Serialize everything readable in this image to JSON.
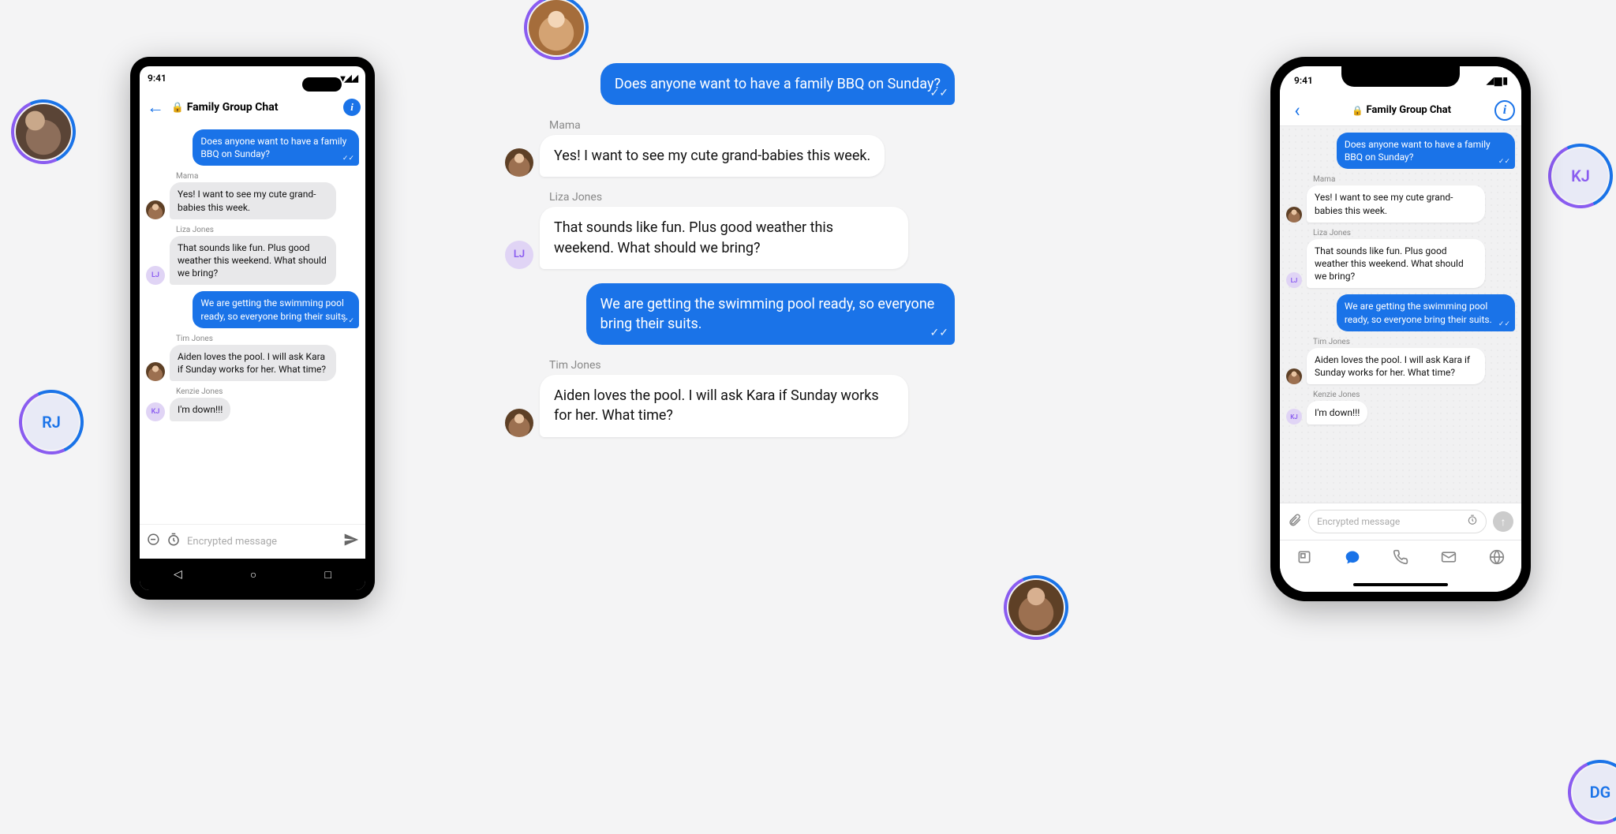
{
  "statusbar": {
    "time": "9:41"
  },
  "header": {
    "title": "Family Group Chat"
  },
  "input": {
    "placeholder": "Encrypted message"
  },
  "messages": [
    {
      "side": "right",
      "sender": "",
      "text": "Does anyone want to have a family BBQ on Sunday?",
      "avatar": "",
      "ticks": true
    },
    {
      "side": "left",
      "sender": "Mama",
      "text": "Yes! I want to see my cute grand-babies this week.",
      "avatar": "photo"
    },
    {
      "side": "left",
      "sender": "Liza Jones",
      "text": "That sounds like fun. Plus good weather this weekend. What should we bring?",
      "avatar": "LJ"
    },
    {
      "side": "right",
      "sender": "",
      "text": "We are getting the swimming pool ready, so everyone bring their suits.",
      "avatar": "",
      "ticks": true
    },
    {
      "side": "left",
      "sender": "Tim Jones",
      "text": "Aiden loves the pool. I will ask Kara if Sunday works for her. What time?",
      "avatar": "photo"
    },
    {
      "side": "left",
      "sender": "Kenzie Jones",
      "text": "I'm down!!!",
      "avatar": "KJ"
    }
  ],
  "center_messages_limit": 5,
  "float_avatars": {
    "rj": "RJ",
    "kj": "KJ",
    "dg": "DG"
  },
  "colors": {
    "blue": "#1a73e8",
    "purple": "#8a5cf0"
  }
}
